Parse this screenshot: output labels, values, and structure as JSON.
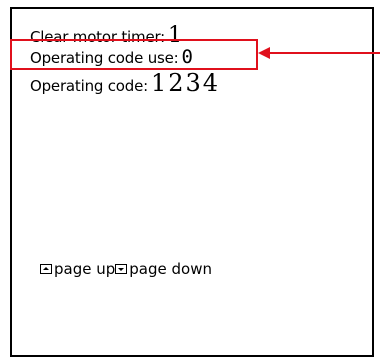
{
  "screen": {
    "rows": [
      {
        "label": "Clear motor timer:",
        "value": "1"
      },
      {
        "label": "Operating code use:",
        "value": "0"
      },
      {
        "label": "Operating code:",
        "value": "1234"
      }
    ],
    "nav": {
      "page_up_icon": "page-up-key-icon",
      "page_up_label": "page up",
      "page_down_icon": "page-down-key-icon",
      "page_down_label": "page down"
    }
  },
  "annotation": {
    "highlight_color": "#e0101c",
    "arrow_color": "#e0101c"
  }
}
